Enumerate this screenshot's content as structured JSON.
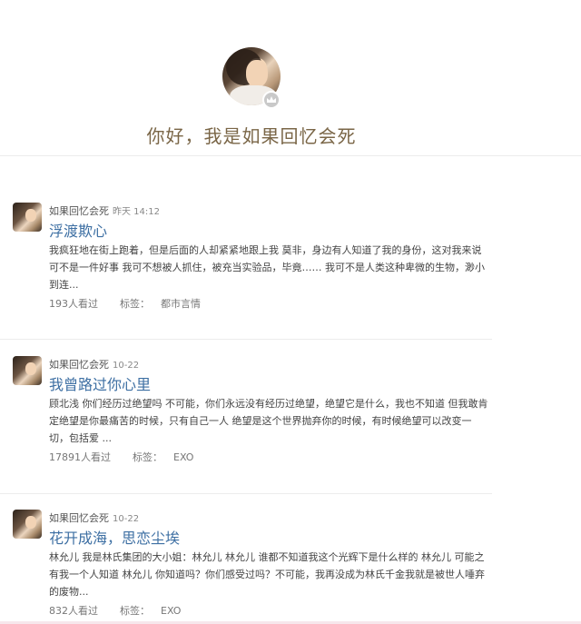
{
  "profile": {
    "name": "你好，我是如果回忆会死"
  },
  "posts": [
    {
      "author": "如果回忆会死",
      "date": "昨天 14:12",
      "title": "浮渡欺心",
      "excerpt": "我疯狂地在街上跑着，但是后面的人却紧紧地跟上我 莫非，身边有人知道了我的身份，这对我来说可不是一件好事 我可不想被人抓住，被充当实验品，毕竟…… 我可不是人类这种卑微的生物，渺小到连...",
      "views": "193人看过",
      "tags_label": "标签：",
      "tag": "都市言情"
    },
    {
      "author": "如果回忆会死",
      "date": "10-22",
      "title": "我曾路过你心里",
      "excerpt": "顾北浅 你们经历过绝望吗 不可能，你们永远没有经历过绝望，绝望它是什么，我也不知道 但我敢肯定绝望是你最痛苦的时候，只有自己一人 绝望是这个世界抛弃你的时候，有时候绝望可以改变一切，包括爱 ...",
      "views": "17891人看过",
      "tags_label": "标签：",
      "tag": "EXO"
    },
    {
      "author": "如果回忆会死",
      "date": "10-22",
      "title": "花开成海，思恋尘埃",
      "excerpt": "林允儿 我是林氏集团的大小姐：林允儿 林允儿 谁都不知道我这个光辉下是什么样的 林允儿 可能之有我一个人知道 林允儿 你知道吗？你们感受过吗？不可能，我再没成为林氏千金我就是被世人唾弃的废物...",
      "views": "832人看过",
      "tags_label": "标签：",
      "tag": "EXO"
    }
  ]
}
